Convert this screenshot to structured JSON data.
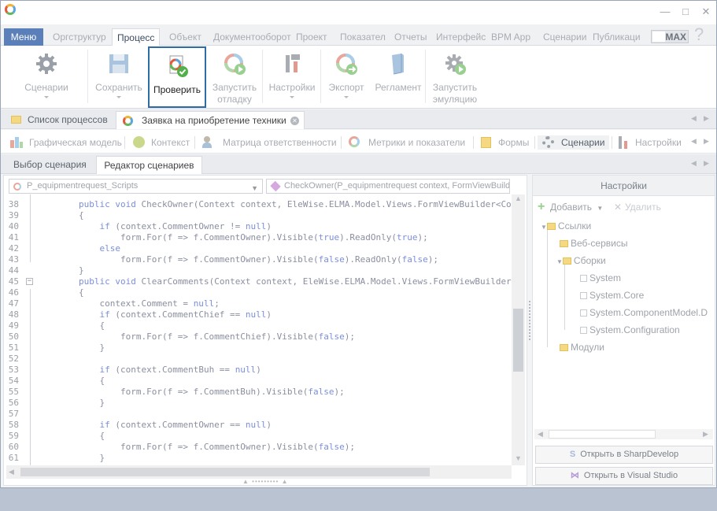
{
  "menu": {
    "menu_button": "Меню",
    "tabs": [
      "Оргструктур",
      "Процесс",
      "Объект",
      "Документооборот",
      "Проект",
      "Показател",
      "Отчеты",
      "Интерфейс",
      "BPM App",
      "Сценарии",
      "Публикаци"
    ],
    "active_tab": "Процесс",
    "max_label": "MAX",
    "help": "?"
  },
  "ribbon": {
    "buttons": [
      {
        "label": "Сценарии",
        "icon": "gear-icon"
      },
      {
        "label": "Сохранить",
        "icon": "save-icon"
      },
      {
        "label": "Проверить",
        "icon": "check-process-icon"
      },
      {
        "label": "Запустить отладку",
        "icon": "debug-run-icon"
      },
      {
        "label": "Настройки",
        "icon": "tools-icon"
      },
      {
        "label": "Экспорт",
        "icon": "export-icon"
      },
      {
        "label": "Регламент",
        "icon": "document-icon"
      },
      {
        "label": "Запустить эмуляцию",
        "icon": "gear-run-icon"
      }
    ]
  },
  "doc_tabs": [
    "Список процессов",
    "Заявка на приобретение техники"
  ],
  "nav_tabs": [
    "Графическая модель",
    "Контекст",
    "Матрица ответственности",
    "Метрики и показатели",
    "Формы",
    "Сценарии",
    "Настройки"
  ],
  "active_nav_tab": "Сценарии",
  "sub_tabs": [
    "Выбор сценария",
    "Редактор сценариев"
  ],
  "editor": {
    "class_combo": "P_equipmentrequest_Scripts",
    "method_combo": "CheckOwner(P_equipmentrequest context, FormViewBuild",
    "top_partial": "        public void CheckOwner(Context context, EleWise.ELMA.Model.Views.FormViewBuilder<Con",
    "lines": [
      {
        "n": "38",
        "t": ""
      },
      {
        "n": "39",
        "t": "        {"
      },
      {
        "n": "40",
        "t": "            if (context.CommentOwner != null)"
      },
      {
        "n": "41",
        "t": "                form.For(f => f.CommentOwner).Visible(true).ReadOnly(true);"
      },
      {
        "n": "42",
        "t": "            else"
      },
      {
        "n": "43",
        "t": "                form.For(f => f.CommentOwner).Visible(false).ReadOnly(false);"
      },
      {
        "n": "44",
        "t": "        }"
      },
      {
        "n": "45",
        "t": "        public void ClearComments(Context context, EleWise.ELMA.Model.Views.FormViewBuilder<"
      },
      {
        "n": "46",
        "t": "        {"
      },
      {
        "n": "47",
        "t": "            context.Comment = null;"
      },
      {
        "n": "48",
        "t": "            if (context.CommentChief == null)"
      },
      {
        "n": "49",
        "t": "            {"
      },
      {
        "n": "50",
        "t": "                form.For(f => f.CommentChief).Visible(false);"
      },
      {
        "n": "51",
        "t": "            }"
      },
      {
        "n": "52",
        "t": ""
      },
      {
        "n": "53",
        "t": "            if (context.CommentBuh == null)"
      },
      {
        "n": "54",
        "t": "            {"
      },
      {
        "n": "55",
        "t": "                form.For(f => f.CommentBuh).Visible(false);"
      },
      {
        "n": "56",
        "t": "            }"
      },
      {
        "n": "57",
        "t": ""
      },
      {
        "n": "58",
        "t": "            if (context.CommentOwner == null)"
      },
      {
        "n": "59",
        "t": "            {"
      },
      {
        "n": "60",
        "t": "                form.For(f => f.CommentOwner).Visible(false);"
      },
      {
        "n": "61",
        "t": "            }"
      }
    ]
  },
  "settings": {
    "title": "Настройки",
    "add": "Добавить",
    "remove": "Удалить",
    "tree": {
      "links": "Ссылки",
      "web_services": "Веб-сервисы",
      "assemblies": "Сборки",
      "asm": [
        "System",
        "System.Core",
        "System.ComponentModel.D",
        "System.Configuration"
      ],
      "modules": "Модули"
    },
    "open_sharpdevelop": "Открыть в SharpDevelop",
    "open_vs": "Открыть в Visual Studio"
  }
}
